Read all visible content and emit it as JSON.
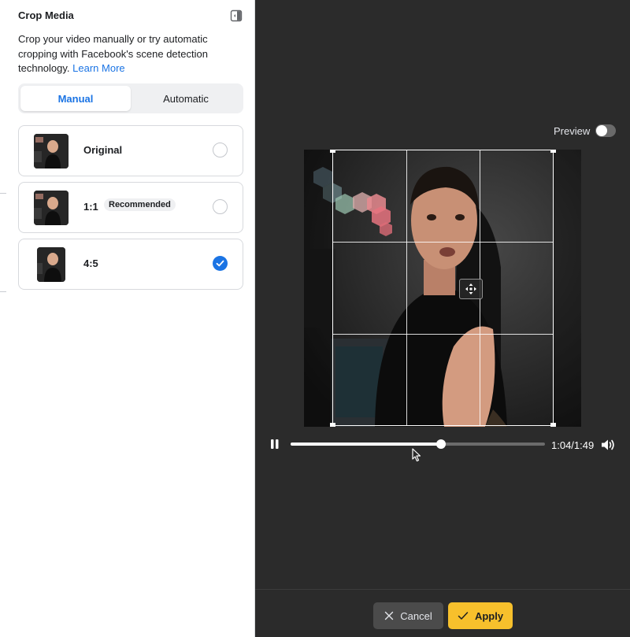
{
  "panel": {
    "title": "Crop Media",
    "description": "Crop your video manually or try automatic cropping with Facebook's scene detection technology.",
    "learn_more": "Learn More"
  },
  "tabs": [
    {
      "label": "Manual",
      "active": true
    },
    {
      "label": "Automatic",
      "active": false
    }
  ],
  "options": [
    {
      "label": "Original",
      "badge": "",
      "selected": false
    },
    {
      "label": "1:1",
      "badge": "Recommended",
      "selected": false
    },
    {
      "label": "4:5",
      "badge": "",
      "selected": true
    }
  ],
  "preview": {
    "label": "Preview",
    "enabled": false
  },
  "player": {
    "time": "1:04/1:49",
    "progress": 0.59,
    "playing": true
  },
  "footer": {
    "cancel_label": "Cancel",
    "apply_label": "Apply"
  },
  "colors": {
    "accent": "#1b74e4",
    "apply": "#f7c02c",
    "dark_bg": "#2b2b2b"
  }
}
